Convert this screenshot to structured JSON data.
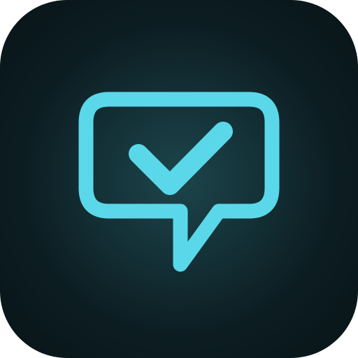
{
  "icon": {
    "name": "chat-check-icon",
    "stroke_color": "#5ad8ea",
    "background_center_color": "#1c454b",
    "background_edge_color": "#081418",
    "outer_background_color": "#ffffff"
  }
}
